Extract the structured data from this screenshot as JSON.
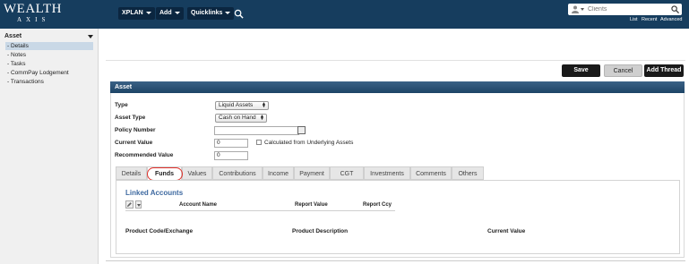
{
  "brand": {
    "line1": "WEALTH",
    "line2": "AXIS"
  },
  "topnav": {
    "xplan": "XPLAN",
    "add": "Add",
    "quicklinks": "Quicklinks",
    "search_icon": "search-icon"
  },
  "client_search": {
    "placeholder": "Clients",
    "links": {
      "list": "List",
      "recent": "Recent",
      "advanced": "Advanced"
    }
  },
  "sidebar": {
    "heading": "Asset",
    "items": [
      {
        "label": "- Details",
        "active": true
      },
      {
        "label": "- Notes"
      },
      {
        "label": "- Tasks"
      },
      {
        "label": "- CommPay Lodgement"
      },
      {
        "label": "- Transactions"
      }
    ]
  },
  "actions": {
    "save": "Save",
    "cancel": "Cancel",
    "add_thread": "Add Thread"
  },
  "panel": {
    "title": "Asset"
  },
  "form": {
    "type": {
      "label": "Type",
      "value": "Liquid Assets"
    },
    "asset_type": {
      "label": "Asset Type",
      "value": "Cash on Hand"
    },
    "policy_number": {
      "label": "Policy Number",
      "value": ""
    },
    "current_value": {
      "label": "Current Value",
      "value": "0",
      "checkbox_label": "Calculated from Underlying Assets"
    },
    "recommended_value": {
      "label": "Recommended Value",
      "value": "0"
    }
  },
  "tabs": [
    "Details",
    "Funds",
    "Values",
    "Contributions",
    "Income",
    "Payment",
    "CGT",
    "Investments",
    "Comments",
    "Others"
  ],
  "active_tab": "Funds",
  "linked_accounts": {
    "title": "Linked Accounts",
    "columns": [
      "Account Name",
      "Report Value",
      "Report Ccy"
    ]
  },
  "products": {
    "columns": [
      "Product Code/Exchange",
      "Product Description",
      "Current Value"
    ]
  },
  "colors": {
    "header_bg": "#163d5e",
    "highlight": "#e0302a",
    "link_blue": "#3f6aa1"
  }
}
